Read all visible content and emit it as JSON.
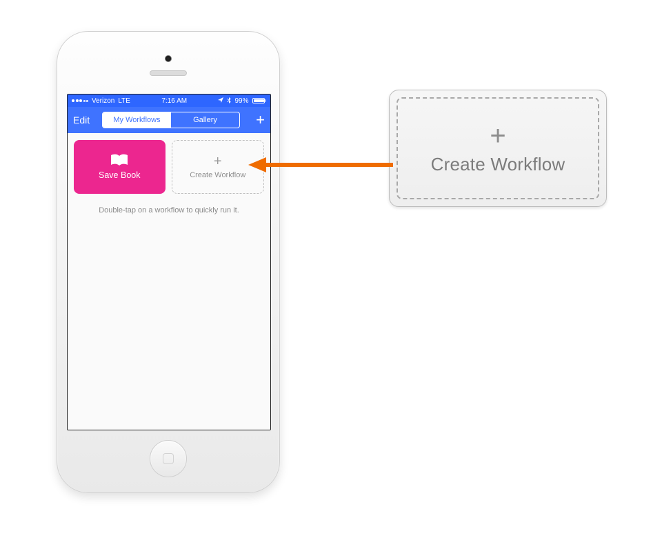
{
  "status": {
    "carrier": "Verizon",
    "network": "LTE",
    "time": "7:16 AM",
    "battery": "99%"
  },
  "nav": {
    "edit": "Edit",
    "tab1": "My Workflows",
    "tab2": "Gallery",
    "plus": "+"
  },
  "tiles": {
    "save_book": "Save Book",
    "create_workflow": "Create Workflow",
    "plus": "+"
  },
  "hint": "Double-tap on a workflow to quickly run it.",
  "callout": {
    "plus": "+",
    "label": "Create Workflow"
  },
  "colors": {
    "brand_blue": "#3f73ff",
    "brand_pink": "#ec268f",
    "arrow_orange": "#ef6c00"
  }
}
